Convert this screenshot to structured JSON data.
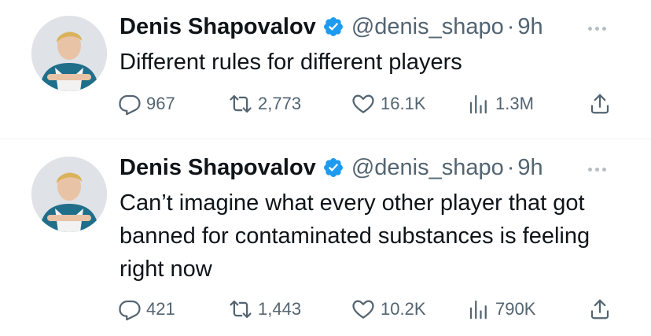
{
  "tweets": [
    {
      "author_name": "Denis Shapovalov",
      "handle": "@denis_shapo",
      "separator": "·",
      "time": "9h",
      "text": "Different rules for different players",
      "replies": "967",
      "retweets": "2,773",
      "likes": "16.1K",
      "views": "1.3M"
    },
    {
      "author_name": "Denis Shapovalov",
      "handle": "@denis_shapo",
      "separator": "·",
      "time": "9h",
      "text": "Can’t imagine what every other player that got banned for contaminated substances is feeling right now",
      "replies": "421",
      "retweets": "1,443",
      "likes": "10.2K",
      "views": "790K"
    }
  ],
  "colors": {
    "text": "#0f1419",
    "secondary": "#536471",
    "verified": "#1d9bf0",
    "divider": "#eff3f4"
  },
  "icons": [
    "verified-badge-icon",
    "more-icon",
    "reply-icon",
    "retweet-icon",
    "like-icon",
    "views-icon",
    "share-icon"
  ]
}
